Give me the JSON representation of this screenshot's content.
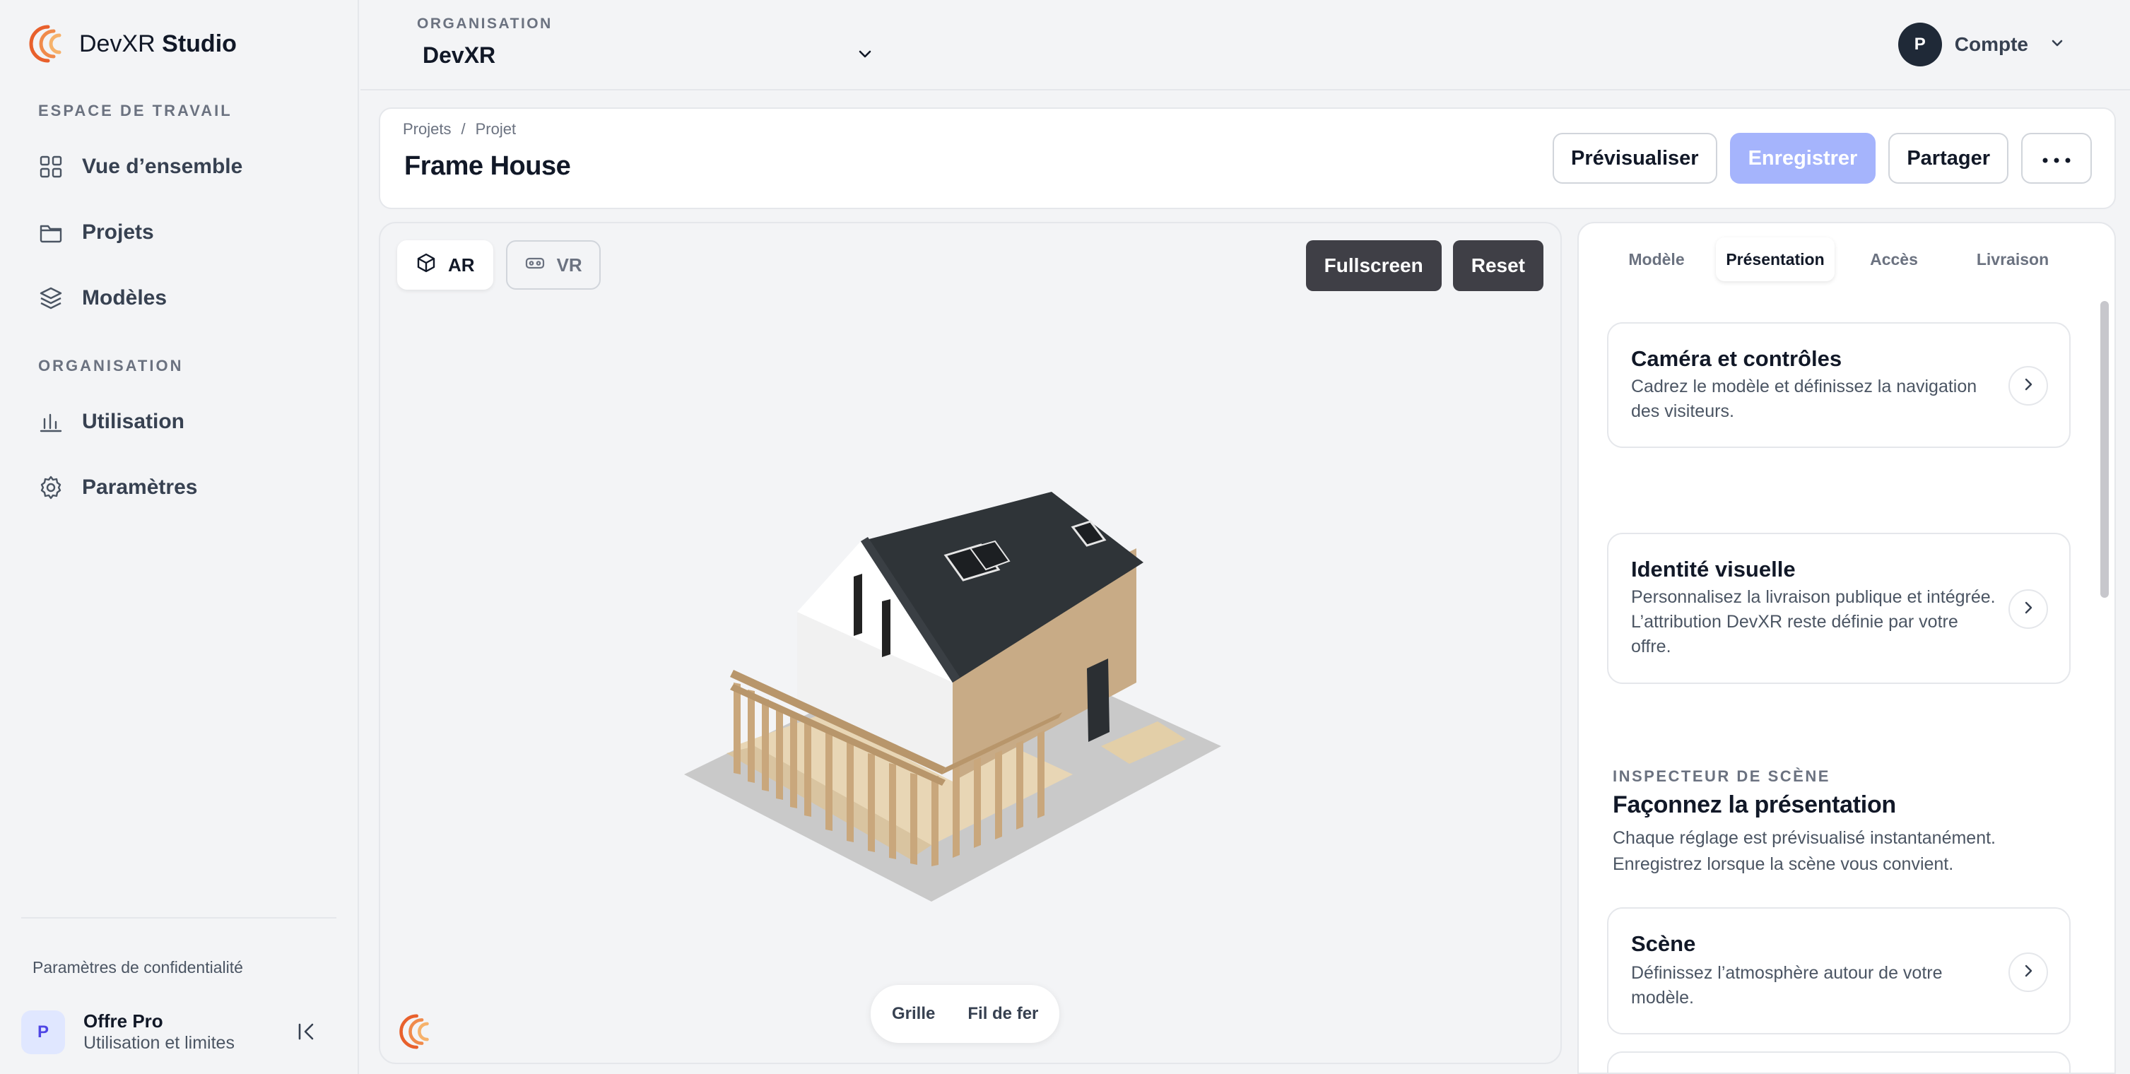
{
  "brand": {
    "name_regular": "DevXR",
    "name_bold": "Studio"
  },
  "sidebar": {
    "workspace_label": "ESPACE DE TRAVAIL",
    "workspace_items": [
      {
        "label": "Vue d’ensemble",
        "icon": "grid-icon"
      },
      {
        "label": "Projets",
        "icon": "folder-icon"
      },
      {
        "label": "Modèles",
        "icon": "layers-icon"
      }
    ],
    "organisation_label": "ORGANISATION",
    "organisation_items": [
      {
        "label": "Utilisation",
        "icon": "bar-chart-icon"
      },
      {
        "label": "Paramètres",
        "icon": "settings-icon"
      }
    ],
    "privacy_link": "Paramètres de confidentialité",
    "plan": {
      "avatar": "P",
      "title": "Offre Pro",
      "subtitle": "Utilisation et limites"
    }
  },
  "topbar": {
    "org_label": "ORGANISATION",
    "org_value": "DevXR",
    "account": {
      "avatar": "P",
      "label": "Compte"
    }
  },
  "project": {
    "breadcrumb": [
      "Projets",
      "/",
      "Projet"
    ],
    "title": "Frame House",
    "actions": {
      "preview": "Prévisualiser",
      "save": "Enregistrer",
      "share": "Partager"
    }
  },
  "viewer": {
    "modes": {
      "ar": "AR",
      "vr": "VR"
    },
    "active_mode": "AR",
    "fullscreen": "Fullscreen",
    "reset": "Reset",
    "toggles": {
      "grid": "Grille",
      "wireframe": "Fil de fer"
    }
  },
  "panel": {
    "tabs": [
      "Modèle",
      "Présentation",
      "Accès",
      "Livraison"
    ],
    "active_tab": "Présentation",
    "cards": [
      {
        "title": "Caméra et contrôles",
        "desc": "Cadrez le modèle et définissez la navigation des visiteurs."
      },
      {
        "title": "Identité visuelle",
        "desc": "Personnalisez la livraison publique et intégrée. L’attribution DevXR reste définie par votre offre."
      },
      {
        "title": "Scène",
        "desc": "Définissez l’atmosphère autour de votre modèle."
      }
    ],
    "inspector": {
      "label": "INSPECTEUR DE SCÈNE",
      "title": "Façonnez la présentation",
      "desc": "Chaque réglage est prévisualisé instantanément. Enregistrez lorsque la scène vous convient."
    }
  },
  "colors": {
    "accent": "#a5b4fc",
    "dark_button": "#3f3f46",
    "brand_orange": "#e8602c",
    "background": "#f3f4f6"
  }
}
